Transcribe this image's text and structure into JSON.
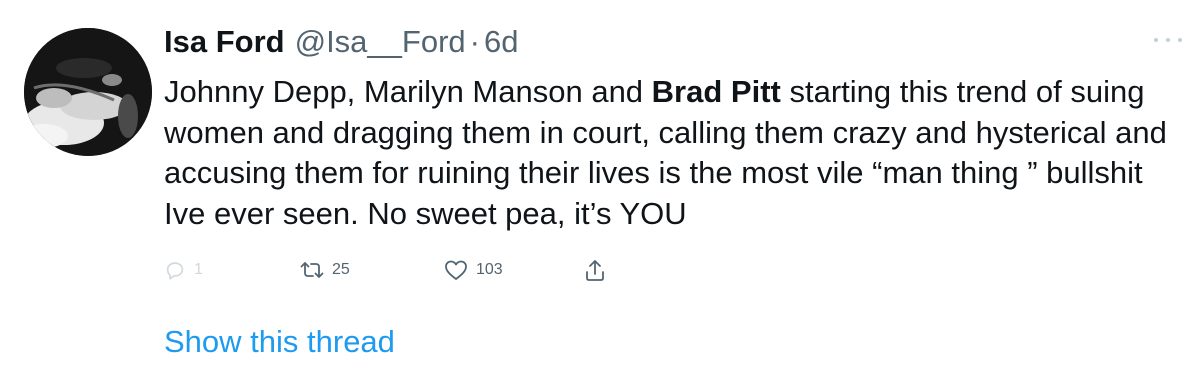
{
  "tweet": {
    "display_name": "Isa Ford",
    "handle": "@Isa__Ford",
    "separator": "·",
    "time": "6d",
    "text_part1": "Johnny Depp, Marilyn Manson and ",
    "text_bold": "Brad Pitt",
    "text_part2": " starting this trend of suing women and dragging them in court, calling them crazy and hysterical and accusing them for ruining their lives is the most vile “man thing ” bullshit Ive ever seen. No sweet pea, it’s YOU"
  },
  "actions": {
    "reply_count": "1",
    "retweet_count": "25",
    "like_count": "103",
    "reply_icon": "reply-icon",
    "retweet_icon": "retweet-icon",
    "like_icon": "heart-icon",
    "share_icon": "share-icon"
  },
  "show_thread": "Show this thread",
  "colors": {
    "text": "#0f1419",
    "secondary": "#536471",
    "link": "#1d9bf0",
    "muted": "#cfd9de"
  }
}
